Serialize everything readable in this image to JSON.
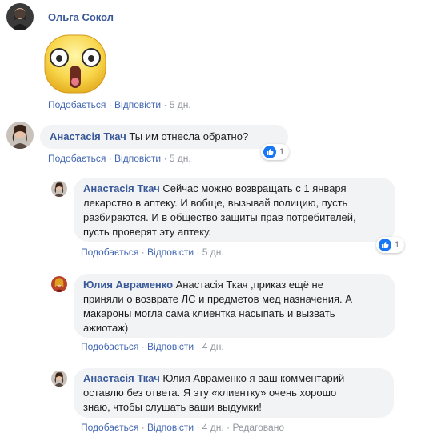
{
  "comments": [
    {
      "author": "Ольга Сокол",
      "sticker": "surprised-face-sticker",
      "actions": {
        "like": "Подобається",
        "reply": "Відповісти",
        "time": "5 дн."
      }
    },
    {
      "author": "Анастасія Ткач",
      "text": "Ты им отнесла обратно?",
      "reactions": {
        "icon": "like-icon",
        "count": "1"
      },
      "actions": {
        "like": "Подобається",
        "reply": "Відповісти",
        "time": "5 дн."
      }
    }
  ],
  "replies": [
    {
      "author": "Анастасія Ткач",
      "lines": [
        "Сейчас можно возвращать с 1 января",
        "лекарство в аптеку. И вобще, вызывай полицию, пусть",
        "разбираются. И в общество защиты прав потребителей,",
        "пусть проверят эту аптеку."
      ],
      "reactions": {
        "icon": "like-icon",
        "count": "1"
      },
      "actions": {
        "like": "Подобається",
        "reply": "Відповісти",
        "time": "5 дн."
      }
    },
    {
      "author": "Юлия Авраменко",
      "lines": [
        "Анастасія Ткач ,приказ ещё не",
        "приняли о возврате ЛС и предметов мед назначения. А",
        "макароны могла сама клиентка насыпать и вызвать",
        "ажиотаж)"
      ],
      "actions": {
        "like": "Подобається",
        "reply": "Відповісти",
        "time": "4 дн."
      }
    },
    {
      "author": "Анастасія Ткач",
      "lines": [
        "Юлия Авраменко я ваш комментарий",
        "оставлю без ответа. Я эту «клиентку» очень хорошо",
        "знаю, чтобы слушать ваши выдумки!"
      ],
      "actions": {
        "like": "Подобається",
        "reply": "Відповісти",
        "time": "4 дн.",
        "edited": "Редаговано"
      }
    }
  ],
  "colors": {
    "link": "#385898",
    "bubble": "#f2f3f5",
    "meta": "#90949c",
    "like_blue": "#1877f2"
  }
}
